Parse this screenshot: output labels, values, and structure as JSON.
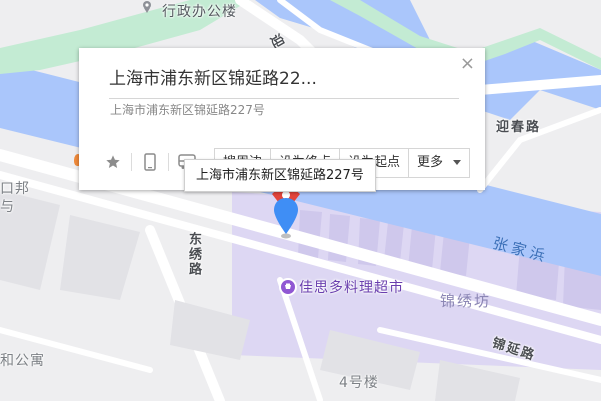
{
  "map_labels": {
    "admin_building": "行政办公楼",
    "road_yingchun": "迎春路",
    "river": "张家浜",
    "area_jinxiufang": "锦绣坊",
    "road_jinyan": "锦延路",
    "road_dongxiu": "东绣路",
    "poi_supermarket": "佳思多料理超市",
    "building_4": "4号楼",
    "apartment": "和公寓",
    "left_bang": "口邦",
    "left_fragment": "与",
    "road_fragment": "迎"
  },
  "info_window": {
    "title": "上海市浦东新区锦延路22...",
    "address": "上海市浦东新区锦延路227号",
    "close": "×",
    "buttons": [
      "搜周边",
      "设为终点",
      "设为起点",
      "更多"
    ]
  },
  "tooltip": {
    "text": "上海市浦东新区锦延路227号"
  },
  "colors": {
    "water": "#aac6fb",
    "area": "#ddd7f3",
    "green": "#c3ebd3",
    "road": "#ffffff",
    "background": "#eeeef0",
    "marker_blue": "#3f8ef5",
    "marker_red": "#e2443b"
  },
  "icons": {
    "star": "star-icon",
    "phone": "phone-icon",
    "bus": "bus-icon",
    "marker": "location-pin-icon",
    "poi": "shopping-poi-icon"
  }
}
